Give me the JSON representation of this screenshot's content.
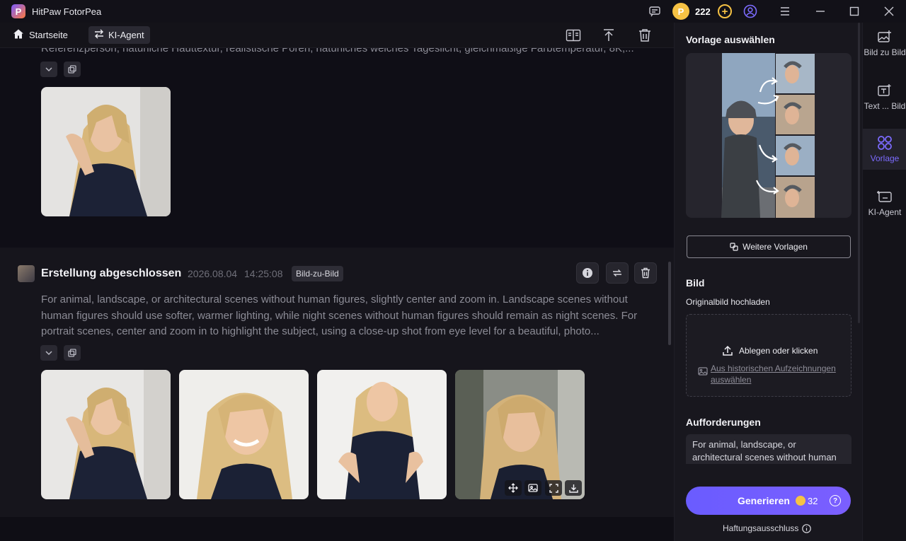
{
  "app": {
    "title": "HitPaw FotorPea",
    "logo_letter": "P"
  },
  "titlebar": {
    "coins": "222"
  },
  "nav": {
    "home_label": "Startseite",
    "agent_label": "KI-Agent"
  },
  "card1": {
    "prompt": "Referenzperson, natürliche Hauttextur, realistische Poren, natürliches weiches Tageslicht, gleichmäßige Farbtemperatur, 8K,..."
  },
  "card2": {
    "title": "Erstellung abgeschlossen",
    "date": "2026.08.04",
    "time": "14:25:08",
    "tag": "Bild-zu-Bild",
    "prompt": "For animal, landscape, or architectural scenes without human figures, slightly center and zoom in. Landscape scenes without human figures should use softer, warmer lighting, while night scenes without human figures should remain as night scenes. For portrait scenes, center and zoom in to highlight the subject, using a close-up shot from eye level for a beautiful, photo..."
  },
  "panel": {
    "template_heading": "Vorlage auswählen",
    "more_templates": "Weitere Vorlagen",
    "image_heading": "Bild",
    "upload_label": "Originalbild hochladen",
    "drop_label": "Ablegen oder klicken",
    "history_link": "Aus historischen Aufzeichnungen auswählen",
    "prompts_heading": "Aufforderungen",
    "prompt_value": "For animal, landscape, or architectural scenes without human",
    "generate_label": "Generieren",
    "generate_cost": "32",
    "disclaimer": "Haftungsausschluss"
  },
  "rail": {
    "items": [
      {
        "label": "Bild zu Bild",
        "icon": "image-add-icon"
      },
      {
        "label": "Text ... Bild",
        "icon": "text-image-icon"
      },
      {
        "label": "Vorlage",
        "icon": "grid-icon",
        "active": true
      },
      {
        "label": "KI-Agent",
        "icon": "agent-icon"
      }
    ]
  },
  "colors": {
    "accent": "#6a5cff",
    "coin": "#f6c244",
    "background": "#0f0e15"
  }
}
